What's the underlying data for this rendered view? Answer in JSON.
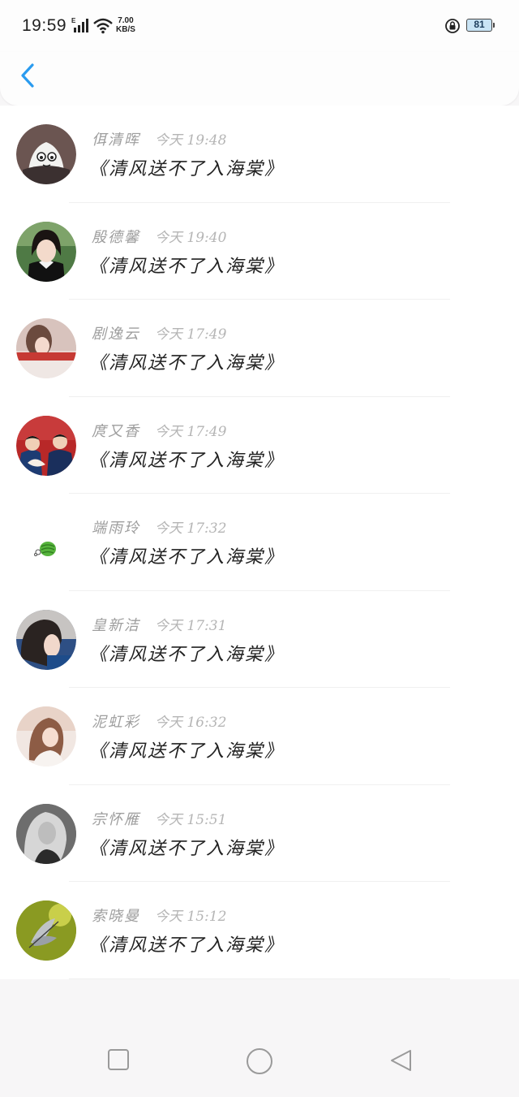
{
  "status_bar": {
    "time": "19:59",
    "signal_label": "E",
    "net_speed_value": "7.00",
    "net_speed_unit": "KB/S",
    "battery_level": "81"
  },
  "nav": {
    "back_icon": "chevron-left-icon",
    "accent_color": "#2a9bef"
  },
  "messages": [
    {
      "name": "佴清晖",
      "time": "今天 19:48",
      "text": "《清风送不了入海棠》"
    },
    {
      "name": "殷德馨",
      "time": "今天 19:40",
      "text": "《清风送不了入海棠》"
    },
    {
      "name": "剧逸云",
      "time": "今天 17:49",
      "text": "《清风送不了入海棠》"
    },
    {
      "name": "庹又香",
      "time": "今天 17:49",
      "text": "《清风送不了入海棠》"
    },
    {
      "name": "端雨玲",
      "time": "今天 17:32",
      "text": "《清风送不了入海棠》"
    },
    {
      "name": "皇新洁",
      "time": "今天 17:31",
      "text": "《清风送不了入海棠》"
    },
    {
      "name": "泥虹彩",
      "time": "今天 16:32",
      "text": "《清风送不了入海棠》"
    },
    {
      "name": "宗怀雁",
      "time": "今天 15:51",
      "text": "《清风送不了入海棠》"
    },
    {
      "name": "索晓曼",
      "time": "今天 15:12",
      "text": "《清风送不了入海棠》"
    }
  ],
  "bottom_nav": {
    "recent_icon": "square-icon",
    "home_icon": "circle-icon",
    "back_icon": "triangle-back-icon"
  }
}
